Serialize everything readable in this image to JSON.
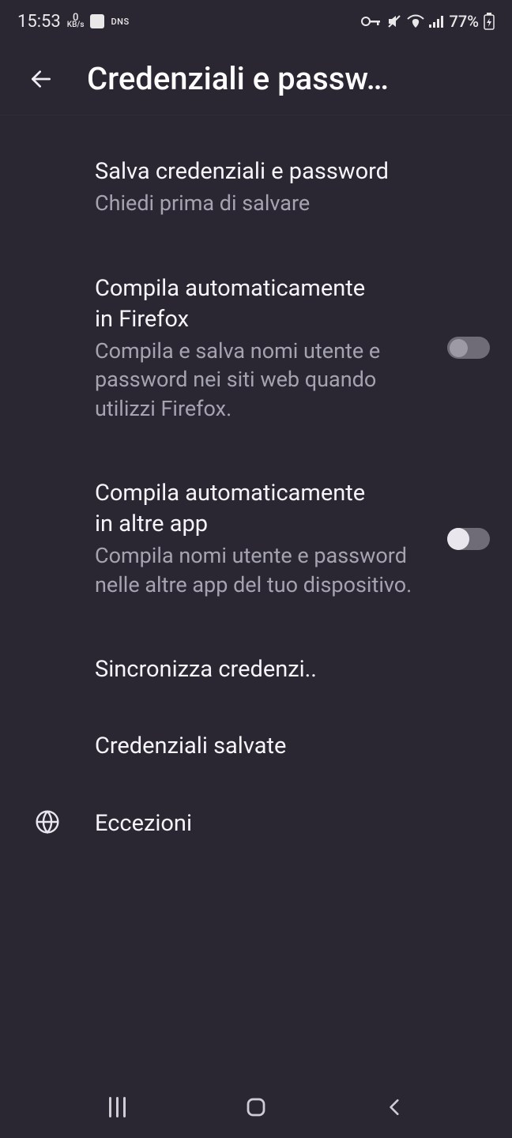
{
  "status": {
    "time": "15:53",
    "kbs_value": "0",
    "kbs_unit": "KB/s",
    "dns": "DNS",
    "battery_pct": "77%"
  },
  "header": {
    "title": "Credenziali e passw…"
  },
  "rows": {
    "save": {
      "title": "Salva credenziali e password",
      "sub": "Chiedi prima di salvare"
    },
    "autofill_firefox": {
      "title": "Compila automaticamente in Firefox",
      "sub": "Compila e salva nomi utente e password nei siti web quando utilizzi Firefox."
    },
    "autofill_other": {
      "title": "Compila automaticamente in altre app",
      "sub": "Compila nomi utente e password nelle altre app del tuo dispositivo."
    },
    "sync": {
      "title": "Sincronizza credenzi.."
    },
    "saved": {
      "title": "Credenziali salvate"
    },
    "exceptions": {
      "title": "Eccezioni"
    }
  }
}
